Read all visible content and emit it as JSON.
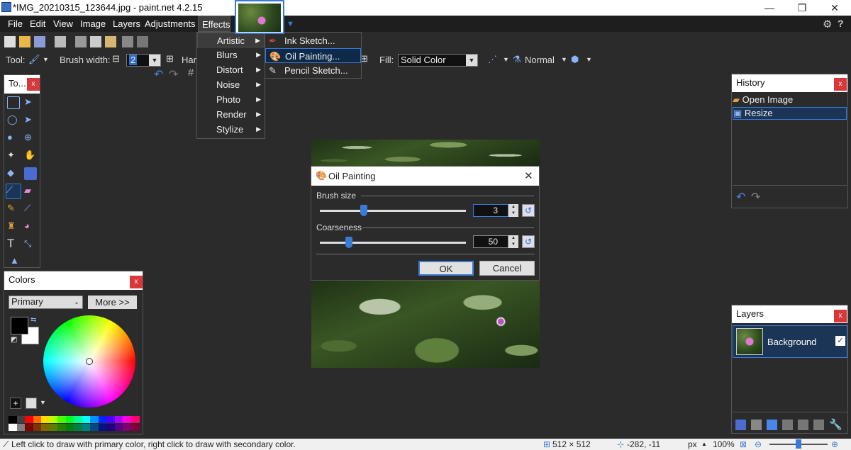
{
  "window": {
    "title": "*IMG_20210315_123644.jpg - paint.net 4.2.15",
    "minimize": "—",
    "restore": "❐",
    "close": "✕"
  },
  "menubar": {
    "items": [
      "File",
      "Edit",
      "View",
      "Image",
      "Layers",
      "Adjustments",
      "Effects"
    ]
  },
  "toolbar": {
    "tool_label": "Tool:",
    "brush_width_label": "Brush width:",
    "brush_width_value": "2",
    "hardness_label": "Hard",
    "fill_label": "Fill:",
    "fill_value": "Solid Color",
    "blend_mode": "Normal"
  },
  "effects_menu": {
    "items": [
      "Artistic",
      "Blurs",
      "Distort",
      "Noise",
      "Photo",
      "Render",
      "Stylize"
    ],
    "selected": "Artistic"
  },
  "artistic_submenu": {
    "items": [
      "Ink Sketch...",
      "Oil Painting...",
      "Pencil Sketch..."
    ],
    "selected": "Oil Painting..."
  },
  "tools_panel": {
    "title": "To...",
    "close": "x"
  },
  "colors_panel": {
    "title": "Colors",
    "close": "x",
    "mode": "Primary",
    "more_button": "More >>",
    "primary_color": "#000000",
    "secondary_color": "#ffffff"
  },
  "history_panel": {
    "title": "History",
    "close": "x",
    "items": [
      "Open Image",
      "Resize"
    ],
    "selected": "Resize"
  },
  "layers_panel": {
    "title": "Layers",
    "close": "x",
    "layers": [
      {
        "name": "Background",
        "visible": true
      }
    ]
  },
  "dialog": {
    "title": "Oil Painting",
    "brush_size_label": "Brush size",
    "brush_size_value": "3",
    "brush_size_fraction": 0.3,
    "coarseness_label": "Coarseness",
    "coarseness_value": "50",
    "coarseness_fraction": 0.2,
    "ok": "OK",
    "cancel": "Cancel"
  },
  "statusbar": {
    "hint": "Left click to draw with primary color, right click to draw with secondary color.",
    "image_size": "512 × 512",
    "cursor_position": "-282, -11",
    "units": "px",
    "zoom": "100%"
  },
  "palette": [
    "#000000",
    "#404040",
    "#ff0000",
    "#ff6a00",
    "#ffd800",
    "#b6ff00",
    "#4cff00",
    "#00ff21",
    "#00ff90",
    "#00ffff",
    "#0094ff",
    "#0026ff",
    "#4800ff",
    "#b200ff",
    "#ff00dc",
    "#ff006e",
    "#ffffff",
    "#808080",
    "#7f0000",
    "#7f3300",
    "#7f6a00",
    "#5b7f00",
    "#267f00",
    "#007f0e",
    "#007f46",
    "#007f7f",
    "#004a7f",
    "#00137f",
    "#21007f",
    "#57007f",
    "#7f006e",
    "#7f0037"
  ],
  "accent_color": "#3a7bd5"
}
